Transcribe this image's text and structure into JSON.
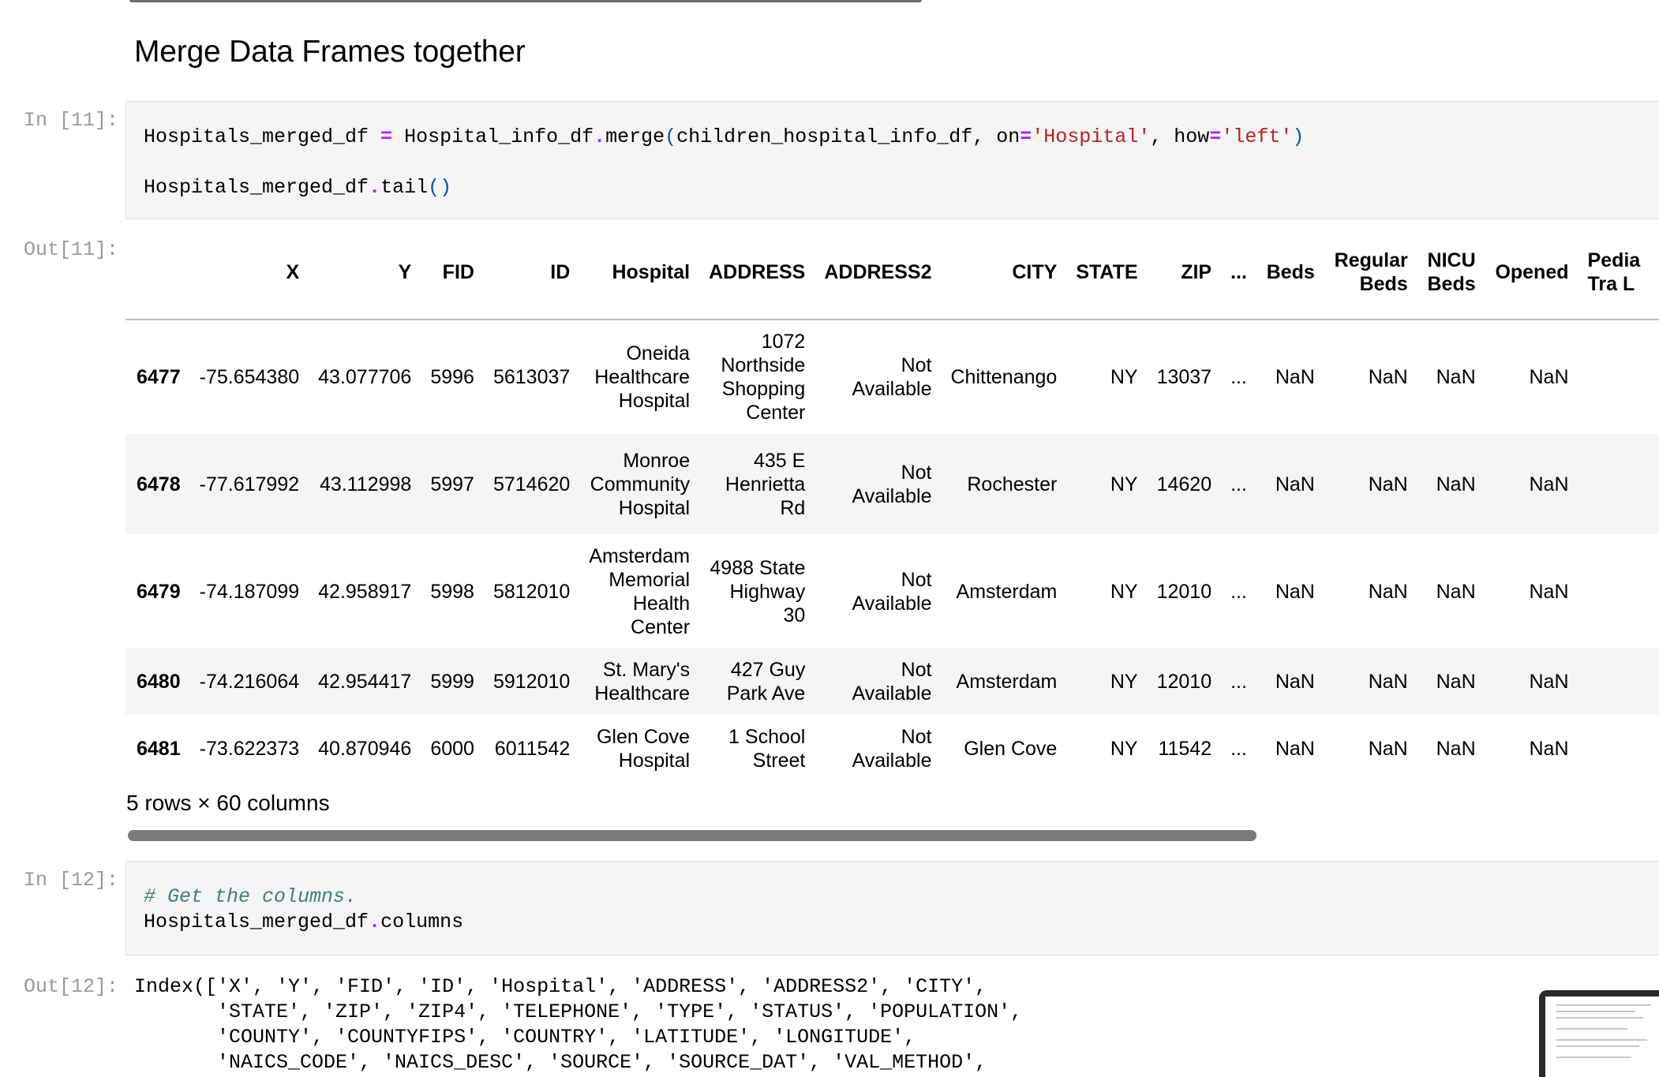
{
  "heading": "Merge Data Frames together",
  "cells": {
    "in11": {
      "prompt": "In [11]:",
      "line1": {
        "a": "Hospitals_merged_df ",
        "eq1": "=",
        "b": " Hospital_info_df",
        "dot": ".",
        "c": "merge",
        "p1": "(",
        "d": "children_hospital_info_df, on",
        "eq2": "=",
        "s1": "'Hospital'",
        "e": ", how",
        "eq3": "=",
        "s2": "'left'",
        "p2": ")"
      },
      "line2": {
        "a": "Hospitals_merged_df",
        "dot": ".",
        "b": "tail",
        "p": "()"
      }
    },
    "out11": {
      "prompt": "Out[11]:",
      "columns": [
        "X",
        "Y",
        "FID",
        "ID",
        "Hospital",
        "ADDRESS",
        "ADDRESS2",
        "CITY",
        "STATE",
        "ZIP",
        "...",
        "Beds",
        "Regular Beds",
        "NICU Beds",
        "Opened",
        "Pedia Tra L"
      ],
      "rows": [
        {
          "index": "6477",
          "X": "-75.654380",
          "Y": "43.077706",
          "FID": "5996",
          "ID": "5613037",
          "Hospital": "Oneida Healthcare Hospital",
          "ADDRESS": "1072 Northside Shopping Center",
          "ADDRESS2": "Not Available",
          "CITY": "Chittenango",
          "STATE": "NY",
          "ZIP": "13037",
          "ellipsis": "...",
          "Beds": "NaN",
          "Regular": "NaN",
          "NICU": "NaN",
          "Opened": "NaN"
        },
        {
          "index": "6478",
          "X": "-77.617992",
          "Y": "43.112998",
          "FID": "5997",
          "ID": "5714620",
          "Hospital": "Monroe Community Hospital",
          "ADDRESS": "435 E Henrietta Rd",
          "ADDRESS2": "Not Available",
          "CITY": "Rochester",
          "STATE": "NY",
          "ZIP": "14620",
          "ellipsis": "...",
          "Beds": "NaN",
          "Regular": "NaN",
          "NICU": "NaN",
          "Opened": "NaN"
        },
        {
          "index": "6479",
          "X": "-74.187099",
          "Y": "42.958917",
          "FID": "5998",
          "ID": "5812010",
          "Hospital": "Amsterdam Memorial Health Center",
          "ADDRESS": "4988 State Highway 30",
          "ADDRESS2": "Not Available",
          "CITY": "Amsterdam",
          "STATE": "NY",
          "ZIP": "12010",
          "ellipsis": "...",
          "Beds": "NaN",
          "Regular": "NaN",
          "NICU": "NaN",
          "Opened": "NaN"
        },
        {
          "index": "6480",
          "X": "-74.216064",
          "Y": "42.954417",
          "FID": "5999",
          "ID": "5912010",
          "Hospital": "St. Mary's Healthcare",
          "ADDRESS": "427 Guy Park Ave",
          "ADDRESS2": "Not Available",
          "CITY": "Amsterdam",
          "STATE": "NY",
          "ZIP": "12010",
          "ellipsis": "...",
          "Beds": "NaN",
          "Regular": "NaN",
          "NICU": "NaN",
          "Opened": "NaN"
        },
        {
          "index": "6481",
          "X": "-73.622373",
          "Y": "40.870946",
          "FID": "6000",
          "ID": "6011542",
          "Hospital": "Glen Cove Hospital",
          "ADDRESS": "1 School Street",
          "ADDRESS2": "Not Available",
          "CITY": "Glen Cove",
          "STATE": "NY",
          "ZIP": "11542",
          "ellipsis": "...",
          "Beds": "NaN",
          "Regular": "NaN",
          "NICU": "NaN",
          "Opened": "NaN"
        }
      ],
      "summary": "5 rows × 60 columns"
    },
    "in12": {
      "prompt": "In [12]:",
      "comment": "# Get the columns.",
      "line2": {
        "a": "Hospitals_merged_df",
        "dot": ".",
        "b": "columns"
      }
    },
    "out12": {
      "prompt": "Out[12]:",
      "lines": [
        "Index(['X', 'Y', 'FID', 'ID', 'Hospital', 'ADDRESS', 'ADDRESS2', 'CITY',",
        "       'STATE', 'ZIP', 'ZIP4', 'TELEPHONE', 'TYPE', 'STATUS', 'POPULATION',",
        "       'COUNTY', 'COUNTYFIPS', 'COUNTRY', 'LATITUDE', 'LONGITUDE',",
        "       'NAICS_CODE', 'NAICS_DESC', 'SOURCE', 'SOURCE_DAT', 'VAL_METHOD',"
      ]
    }
  }
}
